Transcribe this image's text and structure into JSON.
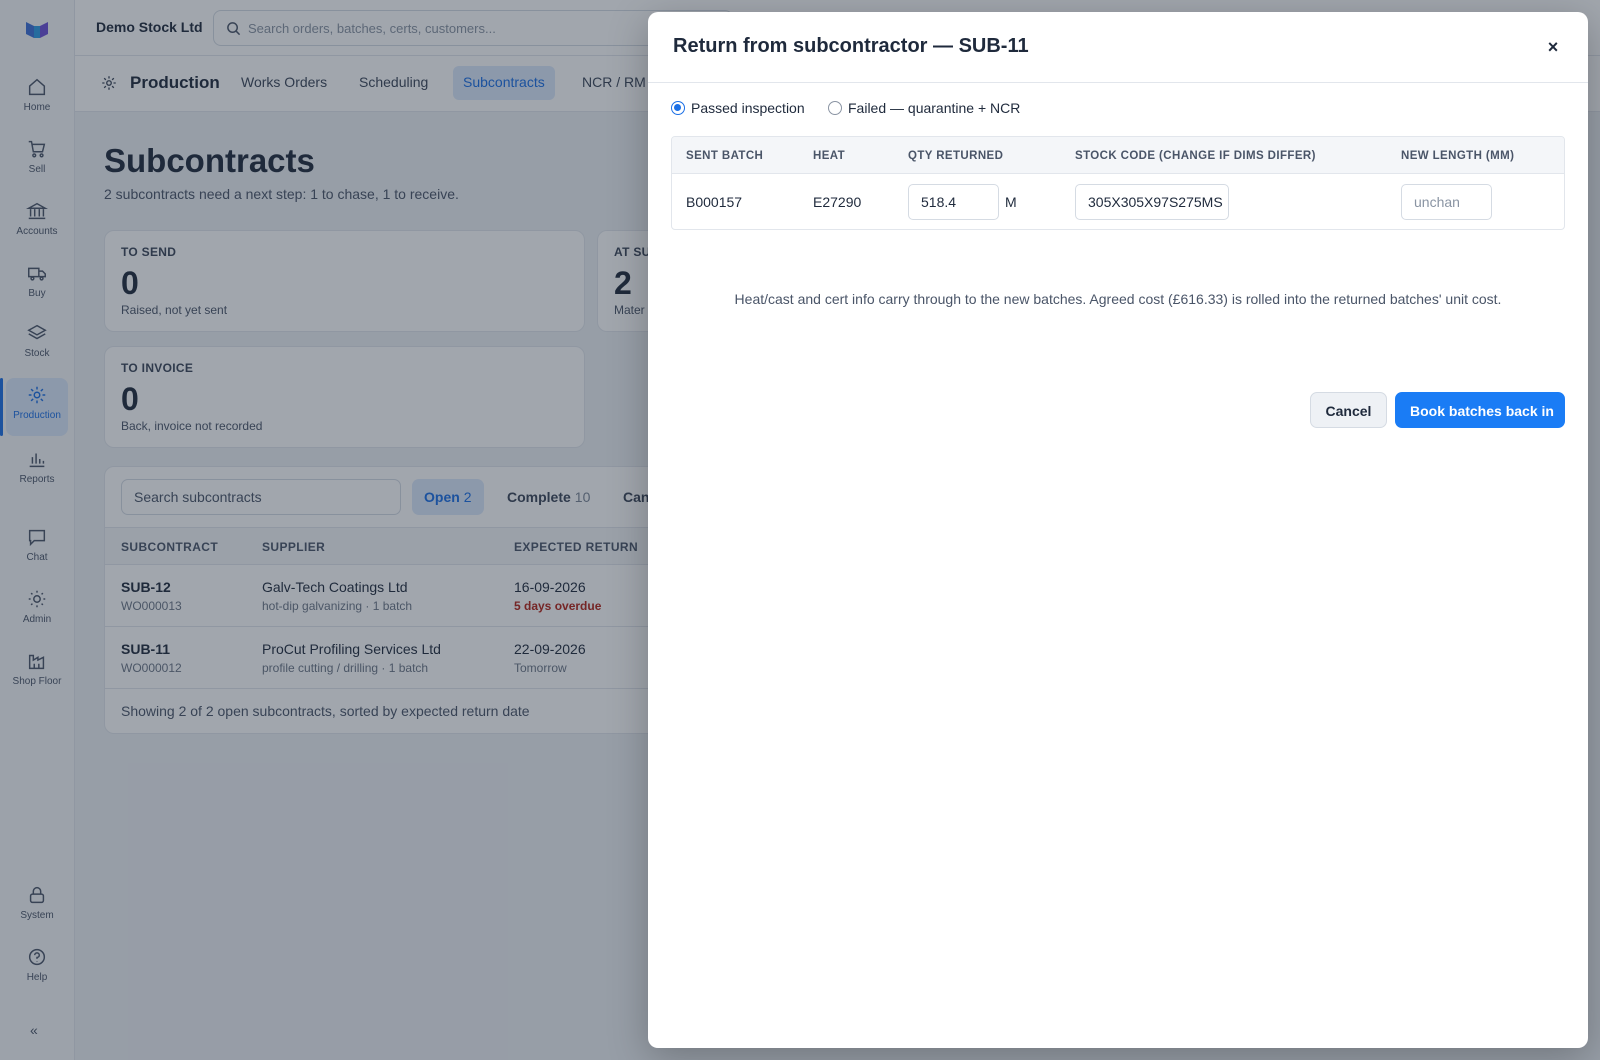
{
  "app": {
    "company": "Demo Stock Ltd",
    "search_placeholder": "Search orders, batches, certs, customers..."
  },
  "sidebar": {
    "items": [
      {
        "label": "Home",
        "icon": "home-icon"
      },
      {
        "label": "Sell",
        "icon": "cart-icon"
      },
      {
        "label": "Accounts",
        "icon": "bank-icon"
      },
      {
        "label": "Buy",
        "icon": "truck-icon"
      },
      {
        "label": "Stock",
        "icon": "layers-icon"
      },
      {
        "label": "Production",
        "icon": "gear-icon",
        "active": true
      },
      {
        "label": "Reports",
        "icon": "bar-chart-icon"
      },
      {
        "label": "Chat",
        "icon": "chat-icon"
      },
      {
        "label": "Admin",
        "icon": "sun-icon"
      },
      {
        "label": "Shop Floor",
        "icon": "factory-icon"
      },
      {
        "label": "System",
        "icon": "lock-icon"
      },
      {
        "label": "Help",
        "icon": "help-icon"
      }
    ],
    "collapse": "«"
  },
  "subnav": {
    "title": "Production",
    "tabs": [
      "Works Orders",
      "Scheduling",
      "Subcontracts",
      "NCR / RM"
    ],
    "active_tab": "Subcontracts"
  },
  "page": {
    "title": "Subcontracts",
    "subtitle": "2 subcontracts need a next step: 1 to chase, 1 to receive."
  },
  "stats": [
    {
      "label": "TO SEND",
      "value": "0",
      "note": "Raised, not yet sent"
    },
    {
      "label": "AT SU",
      "value": "2",
      "note": "Mater"
    },
    {
      "label": "TO INVOICE",
      "value": "0",
      "note": "Back, invoice not recorded"
    }
  ],
  "list": {
    "search_placeholder": "Search subcontracts",
    "filters": [
      {
        "label": "Open",
        "count": "2"
      },
      {
        "label": "Complete",
        "count": "10"
      },
      {
        "label": "Canc",
        "count": ""
      }
    ],
    "columns": [
      "SUBCONTRACT",
      "SUPPLIER",
      "EXPECTED RETURN"
    ],
    "rows": [
      {
        "id": "SUB-12",
        "wo": "WO000013",
        "supplier": "Galv-Tech Coatings Ltd",
        "detail": "hot-dip galvanizing · 1 batch",
        "date": "16-09-2026",
        "status": "5 days overdue"
      },
      {
        "id": "SUB-11",
        "wo": "WO000012",
        "supplier": "ProCut Profiling Services Ltd",
        "detail": "profile cutting / drilling · 1 batch",
        "date": "22-09-2026",
        "status": "Tomorrow"
      }
    ],
    "footer": "Showing 2 of 2 open subcontracts, sorted by expected return date"
  },
  "modal": {
    "title": "Return from subcontractor — SUB-11",
    "close": "×",
    "radio_pass": "Passed inspection",
    "radio_fail": "Failed — quarantine + NCR",
    "columns": [
      "SENT BATCH",
      "HEAT",
      "QTY RETURNED",
      "STOCK CODE (CHANGE IF DIMS DIFFER)",
      "NEW LENGTH (MM)"
    ],
    "row": {
      "batch": "B000157",
      "heat": "E27290",
      "qty": "518.4",
      "unit": "M",
      "stock_code": "305X305X97S275MS",
      "length_placeholder": "unchan"
    },
    "info": "Heat/cast and cert info carry through to the new batches. Agreed cost (£616.33) is rolled into the returned batches' unit cost.",
    "cancel": "Cancel",
    "submit": "Book batches back in"
  },
  "colors": {
    "accent": "#1a7cf5",
    "active_bg": "#dbe8fb",
    "overdue": "#b42318"
  }
}
